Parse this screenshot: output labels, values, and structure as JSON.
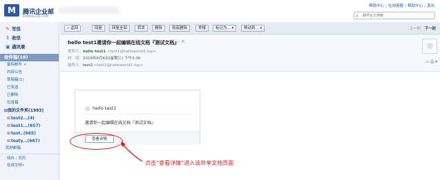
{
  "brand": {
    "logo_letter": "M",
    "title": "腾讯企业邮",
    "domain": "EXMAIL.QQ.COM"
  },
  "topbar": {
    "links": [
      "帮助中心",
      "在线客服",
      "帮助中心",
      "退出"
    ],
    "search_placeholder": "邮件全文搜索"
  },
  "sidebar": {
    "quick": [
      {
        "icon": "pen-icon",
        "glyph": "✎",
        "label": "写信"
      },
      {
        "icon": "inbox-icon",
        "glyph": "⇩",
        "label": "收信"
      },
      {
        "icon": "contacts-icon",
        "glyph": "▣",
        "label": "通讯录"
      }
    ],
    "inbox": "收件箱(18)",
    "folders": [
      {
        "label": "星标邮件",
        "star": "★"
      },
      {
        "label": "内部公告",
        "star": ""
      },
      {
        "label": "草稿箱(1)",
        "star": ""
      },
      {
        "label": "已发送",
        "star": ""
      },
      {
        "label": "已删除",
        "star": ""
      },
      {
        "label": "垃圾箱",
        "star": ""
      }
    ],
    "my_folders": "我的文件夹(1993)",
    "my_folder_items": [
      "test2...(4)",
      "test1...(657)",
      "test..(665)",
      "testy...(667)"
    ],
    "other_mailbox": "其他邮箱",
    "bottom_a": "待办",
    "bottom_sep": "|",
    "bottom_b": "日历",
    "bottom_c": "在线文档"
  },
  "toolbar": {
    "buttons": [
      "« 返回",
      "回复",
      "回复全部",
      "转发",
      "删除",
      "彻底删除",
      "举报",
      "标记为...",
      "移动到..."
    ],
    "dropdown_glyph": "▾",
    "pager_prev": "上一封",
    "pager_next": "下一封"
  },
  "mail": {
    "subject": "hello test1邀请你一起编辑在线文档『测试文档』",
    "subject_icons": "☆ ⇱",
    "from_label": "发件人：",
    "from_name": "hello test1",
    "from_addr": "<test1@helloworld1.top>",
    "time_label": "时　间：",
    "time_value": "2018年6月6日(星期三) 下午3:36",
    "to_label": "收件人：",
    "to_name": "test2",
    "to_addr": "<test2@helloworld1.top>",
    "header_tools": "▭ ⎙ ▾"
  },
  "card": {
    "greeting": "hello test1",
    "body": "邀请你一起编辑在线文档『测试文档』",
    "detail_button": "查看详情"
  },
  "annotation": {
    "text": "点击“查看详情”进入该共享文档页面",
    "color": "#d21c1c"
  },
  "colors": {
    "sidebar_bg": "#f0f4f9",
    "selected_folder": "#7d9cbf",
    "link": "#1f5fb1",
    "sender_green": "#3b7f2a",
    "accent_red": "#d21c1c"
  }
}
